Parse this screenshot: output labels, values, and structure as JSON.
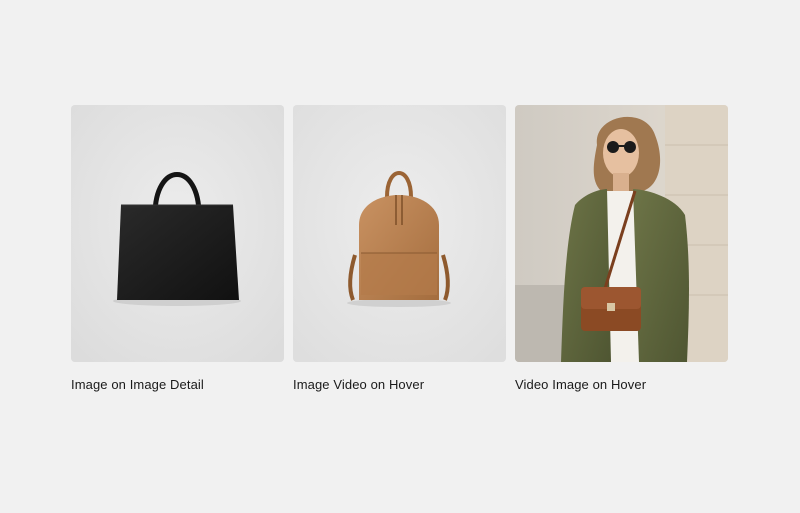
{
  "cards": [
    {
      "caption": "Image on Image Detail",
      "image": "black-leather-handbag"
    },
    {
      "caption": "Image Video on Hover",
      "image": "tan-leather-backpack"
    },
    {
      "caption": "Video Image on Hover",
      "image": "woman-with-brown-crossbody-bag"
    }
  ],
  "colors": {
    "page_background": "#f1f1f1",
    "thumb_background": "#e7e7e7",
    "caption_text": "#1a1a1a"
  }
}
